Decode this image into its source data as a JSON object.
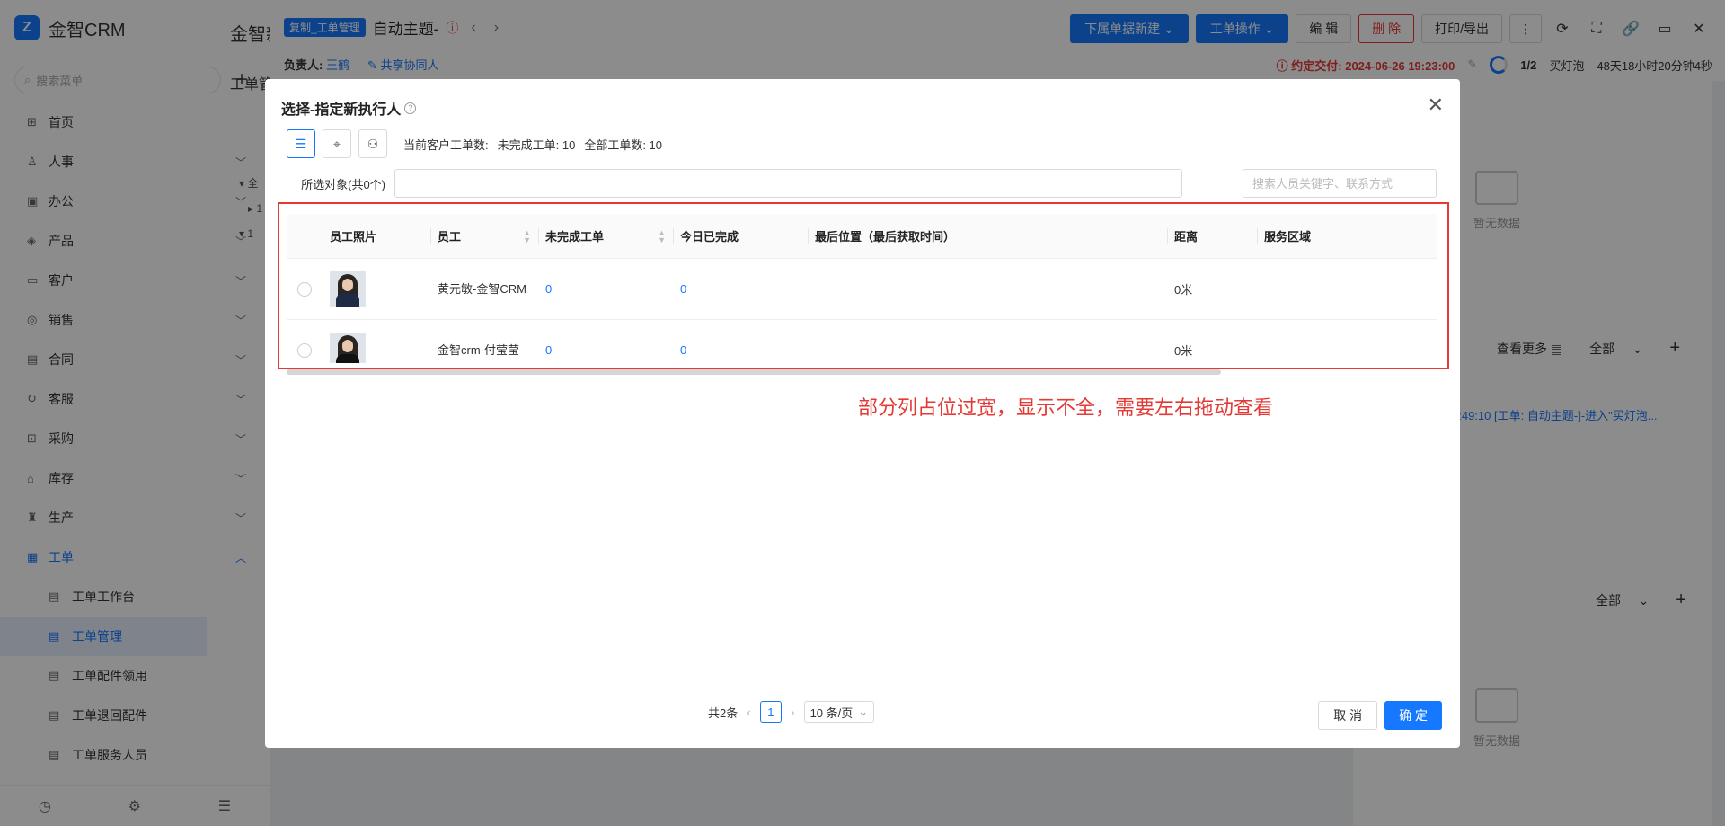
{
  "app": {
    "logo_text": "Z",
    "name": "金智CRM"
  },
  "sidebar": {
    "search_placeholder": "搜索菜单",
    "add_icon": "plus-icon",
    "items": [
      {
        "label": "首页",
        "icon": "home-icon",
        "glyph": "⊞",
        "has_children": false
      },
      {
        "label": "人事",
        "icon": "people-icon",
        "glyph": "♙",
        "has_children": true
      },
      {
        "label": "办公",
        "icon": "briefcase-icon",
        "glyph": "▣",
        "has_children": true
      },
      {
        "label": "产品",
        "icon": "product-icon",
        "glyph": "◈",
        "has_children": true
      },
      {
        "label": "客户",
        "icon": "customer-icon",
        "glyph": "▭",
        "has_children": true
      },
      {
        "label": "销售",
        "icon": "sales-icon",
        "glyph": "◎",
        "has_children": true
      },
      {
        "label": "合同",
        "icon": "contract-icon",
        "glyph": "▤",
        "has_children": true
      },
      {
        "label": "客服",
        "icon": "service-icon",
        "glyph": "↻",
        "has_children": true
      },
      {
        "label": "采购",
        "icon": "purchase-icon",
        "glyph": "⊡",
        "has_children": true
      },
      {
        "label": "库存",
        "icon": "inventory-icon",
        "glyph": "⌂",
        "has_children": true
      },
      {
        "label": "生产",
        "icon": "production-icon",
        "glyph": "♜",
        "has_children": true
      },
      {
        "label": "工单",
        "icon": "workorder-icon",
        "glyph": "▦",
        "has_children": true,
        "expanded": true
      }
    ],
    "sub_items": [
      {
        "label": "工单工作台",
        "icon": "workbench-icon",
        "selected": false
      },
      {
        "label": "工单管理",
        "icon": "manage-icon",
        "selected": true
      },
      {
        "label": "工单配件领用",
        "icon": "parts-icon",
        "selected": false
      },
      {
        "label": "工单退回配件",
        "icon": "return-icon",
        "selected": false
      },
      {
        "label": "工单服务人员",
        "icon": "staff-icon",
        "selected": false
      }
    ]
  },
  "background": {
    "left_title": "金智新",
    "left_subtitle": "工单管",
    "tree": [
      "▾ 全",
      "▸ 1",
      "▾ 1"
    ],
    "tag": "复制_工单管理",
    "title": "自动主题-",
    "owner_label": "负责人:",
    "owner_name": "王鹤",
    "collab": "共享协同人",
    "buttons": {
      "new_sub": "下属单据新建",
      "ops": "工单操作",
      "edit": "编 辑",
      "delete": "删 除",
      "print": "打印/导出"
    },
    "deadline_label": "约定交付:",
    "deadline_value": "2024-06-26 19:23:00",
    "stage": "1/2",
    "stage_name": "买灯泡",
    "remaining": "48天18小时20分钟4秒",
    "empty_text": "暂无数据",
    "see_more": "查看更多",
    "filter_all": "全部",
    "log_snippet": "4:49:10 [工单: 自动主题-]-进入\"买灯泡..."
  },
  "modal": {
    "title": "选择-指定新执行人",
    "stats": {
      "current": "当前客户工单数:",
      "undone": "未完成工单: 10",
      "total": "全部工单数: 10"
    },
    "selected_label": "所选对象(共0个)",
    "search_placeholder": "搜索人员关键字、联系方式",
    "columns": [
      "员工照片",
      "员工",
      "未完成工单",
      "今日已完成",
      "最后位置（最后获取时间）",
      "距离",
      "服务区域"
    ],
    "rows": [
      {
        "employee": "黄元敏-金智CRM",
        "undone": "0",
        "today_done": "0",
        "last_location": "",
        "distance": "0米",
        "area": ""
      },
      {
        "employee": "金智crm-付莹莹",
        "undone": "0",
        "today_done": "0",
        "last_location": "",
        "distance": "0米",
        "area": ""
      }
    ],
    "annotation": "部分列占位过宽，显示不全，需要左右拖动查看",
    "pager": {
      "total": "共2条",
      "current_page": "1",
      "page_size": "10 条/页"
    },
    "cancel": "取 消",
    "confirm": "确 定"
  },
  "colors": {
    "primary": "#1677ff",
    "danger": "#e53935",
    "overlay": "rgba(0,0,0,0.45)"
  }
}
